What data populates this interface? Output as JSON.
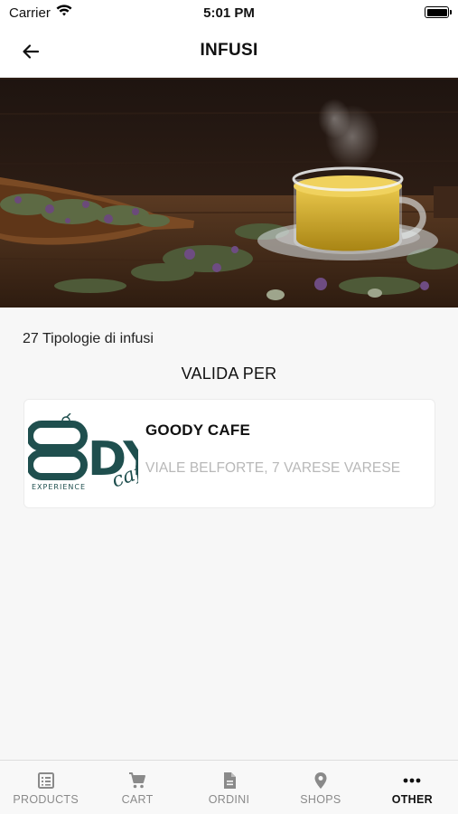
{
  "status_bar": {
    "carrier": "Carrier",
    "time": "5:01 PM"
  },
  "header": {
    "title": "INFUSI",
    "back_icon": "arrow-left-icon"
  },
  "hero_image": {
    "subject": "herbal-tea-cup-with-dried-herbs"
  },
  "content": {
    "count_text": "27 Tipologie di infusi",
    "valid_for_title": "VALIDA PER"
  },
  "shop": {
    "name": "GOODY CAFE",
    "address": "VIALE BELFORTE, 7 VARESE VARESE",
    "logo": {
      "big_letters": "DY",
      "script": "caf",
      "tagline": "EXPERIENCE",
      "color": "#1f4f4e"
    }
  },
  "tabs": [
    {
      "label": "PRODUCTS",
      "icon": "list-icon",
      "active": false
    },
    {
      "label": "CART",
      "icon": "cart-icon",
      "active": false
    },
    {
      "label": "ORDINI",
      "icon": "document-icon",
      "active": false
    },
    {
      "label": "SHOPS",
      "icon": "map-pin-icon",
      "active": false
    },
    {
      "label": "OTHER",
      "icon": "more-dots-icon",
      "active": true
    }
  ],
  "colors": {
    "tab_active": "#111111",
    "tab_inactive": "#8a8a8a",
    "address_gray": "#b8b8b8",
    "logo_teal": "#1f4f4e"
  }
}
